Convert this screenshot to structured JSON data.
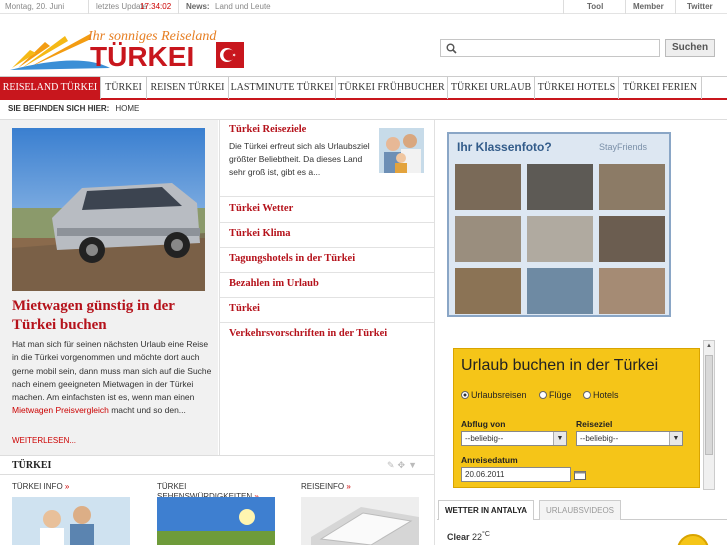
{
  "topbar": {
    "date": "Montag, 20. Juni",
    "update_label": "letztes Update",
    "update_time": "17:34:02",
    "news_label": "News:",
    "news_text": "Land und Leute",
    "links": [
      "Tool",
      "Member",
      "Twitter"
    ]
  },
  "logo": {
    "tagline": "Ihr sonniges Reiseland",
    "wordmark": "TÜRKEI"
  },
  "search": {
    "placeholder": "",
    "button": "Suchen"
  },
  "nav": {
    "items": [
      "REISELAND TÜRKEI",
      "TÜRKEI",
      "REISEN TÜRKEI",
      "LASTMINUTE TÜRKEI",
      "TÜRKEI FRÜHBUCHER",
      "TÜRKEI URLAUB",
      "TÜRKEI HOTELS",
      "TÜRKEI FERIEN"
    ]
  },
  "breadcrumb": {
    "label": "SIE BEFINDEN SICH HIER:",
    "current": "HOME"
  },
  "feature": {
    "title": "Mietwagen günstig in der Türkei buchen",
    "text_before": "Hat man sich für seinen nächsten Urlaub eine Reise in die Türkei vorgenommen und möchte dort auch gerne mobil sein, dann muss man sich auf die Suche nach einem geeigneten Mietwagen in der Türkei machen. Am einfachsten ist es, wenn man einen ",
    "text_link": "Mietwagen Preisvergleich",
    "text_after": " macht und so den...",
    "more": "WEITERLESEN..."
  },
  "middle": {
    "first_title": "Türkei Reiseziele",
    "first_desc": "Die Türkei erfreut sich als Urlaubsziel größter Beliebtheit. Da dieses Land sehr groß ist, gibt es a...",
    "items": [
      "Türkei Wetter",
      "Türkei Klima",
      "Tagungshotels in der Türkei",
      "Bezahlen im Urlaub",
      "Türkei",
      "Verkehrsvorschriften in der Türkei"
    ]
  },
  "ad": {
    "title": "Ihr Klassenfoto?",
    "brand": "StayFriends"
  },
  "booking": {
    "title": "Urlaub buchen in der Türkei",
    "options": [
      "Urlaubsreisen",
      "Flüge",
      "Hotels"
    ],
    "selected_option": "Urlaubsreisen",
    "from_label": "Abflug von",
    "from_value": "--beliebig--",
    "dest_label": "Reiseziel",
    "dest_value": "--beliebig--",
    "date_label": "Anreisedatum",
    "date_value": "20.06.2011"
  },
  "bottom": {
    "title": "TÜRKEI",
    "col1": "TÜRKEI INFO",
    "col2_line1": "TÜRKEI",
    "col2_line2": "SEHENSWÜRDIGKEITEN",
    "col3": "REISEINFO",
    "chevron": "»"
  },
  "weather": {
    "tab_active": "WETTER IN ANTALYA",
    "tab_inactive": "URLAUBSVIDEOS",
    "condition": "Clear",
    "temperature": "22",
    "unit": "°C"
  },
  "colors": {
    "brand_red": "#c8161d",
    "link_red": "#b5121b",
    "booking_yellow": "#f5c518"
  }
}
